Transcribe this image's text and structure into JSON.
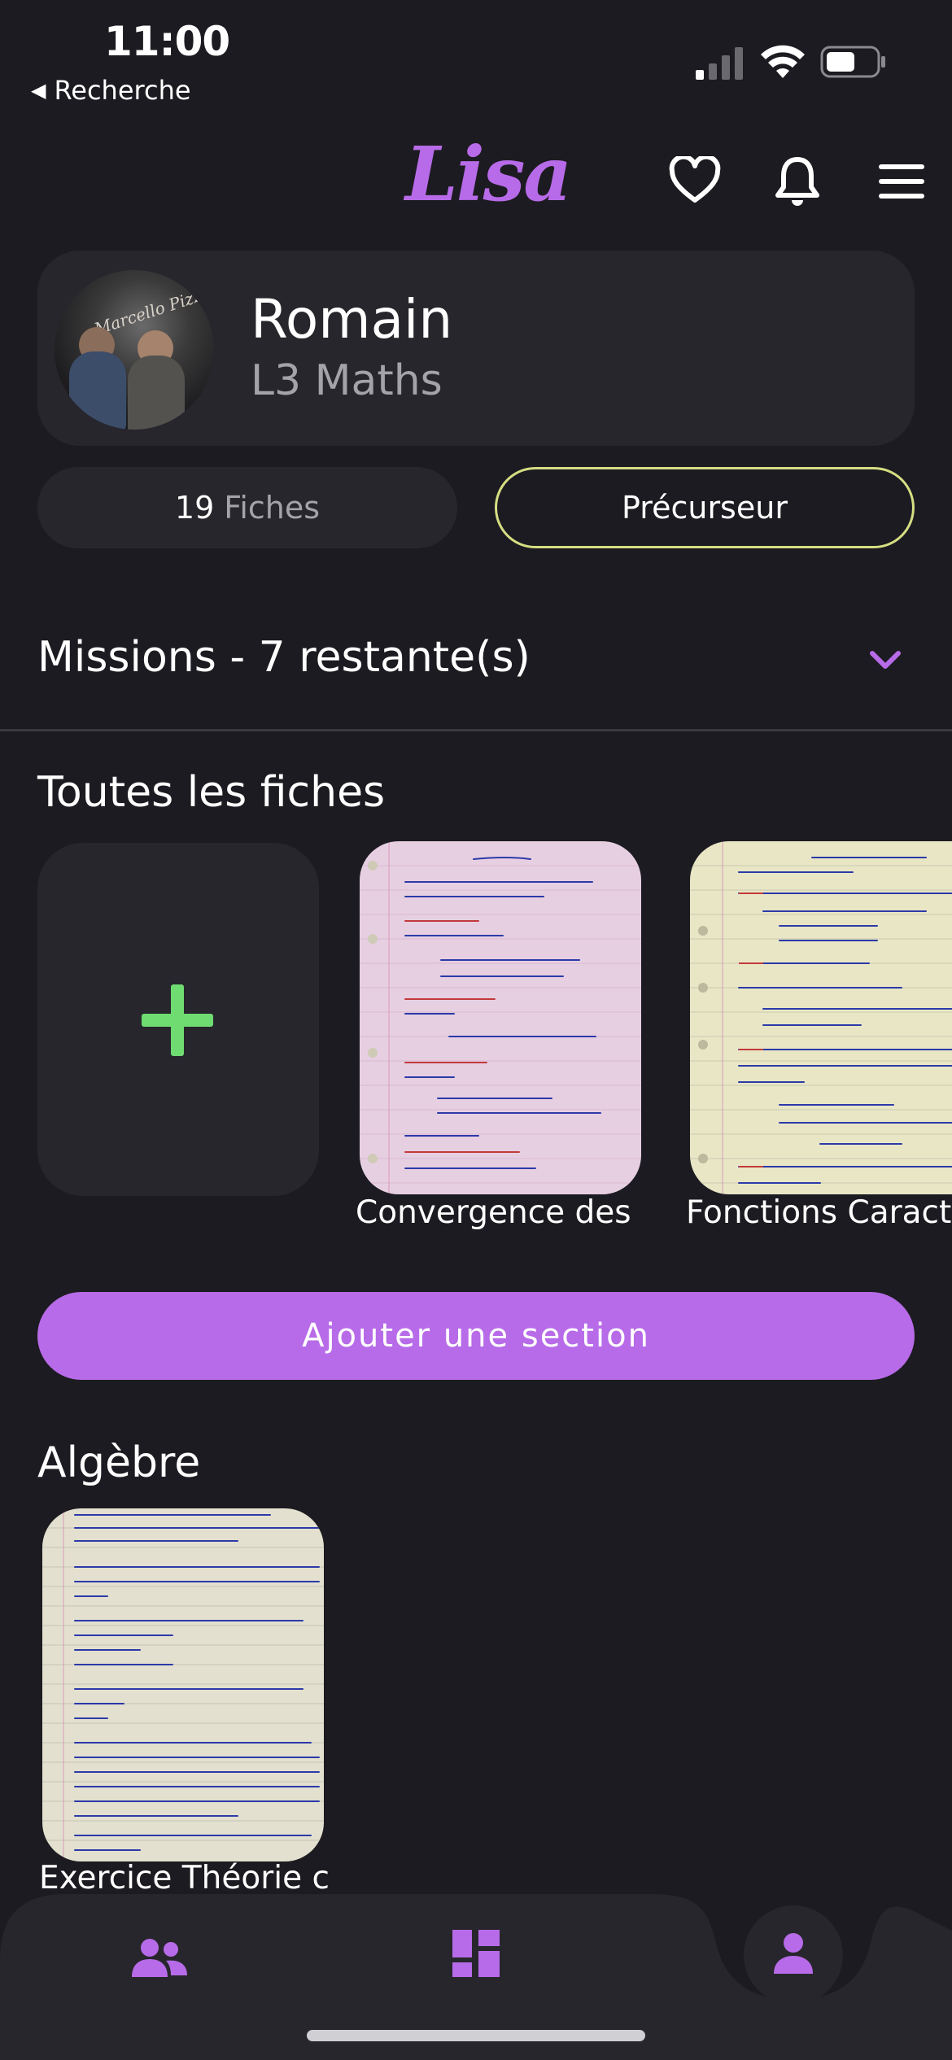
{
  "status_bar": {
    "time": "11:00",
    "back_label": "Recherche",
    "back_arrow": "◀"
  },
  "header": {
    "logo": "Lisa",
    "icons": [
      "heart-icon",
      "bell-icon",
      "menu-icon"
    ]
  },
  "profile": {
    "name": "Romain",
    "subtitle": "L3 Maths",
    "fiches_count": "19",
    "fiches_label": "Fiches",
    "badge": "Précurseur"
  },
  "missions": {
    "label": "Missions - 7 restante(s)"
  },
  "all_notes": {
    "title": "Toutes les fiches",
    "items": [
      {
        "title": "Convergence des v"
      },
      {
        "title": "Fonctions Caract"
      }
    ]
  },
  "add_section_label": "Ajouter une section",
  "algebre": {
    "title": "Algèbre",
    "items": [
      {
        "title": "Exercice Théorie c"
      }
    ]
  },
  "colors": {
    "accent": "#b76be8",
    "badge_border": "#d6de83",
    "plus": "#6fdc72",
    "background": "#1c1b21",
    "card": "#27262c"
  },
  "bottom_nav": {
    "items": [
      "community-icon",
      "dashboard-icon",
      "profile-icon"
    ],
    "active": "profile-icon"
  }
}
